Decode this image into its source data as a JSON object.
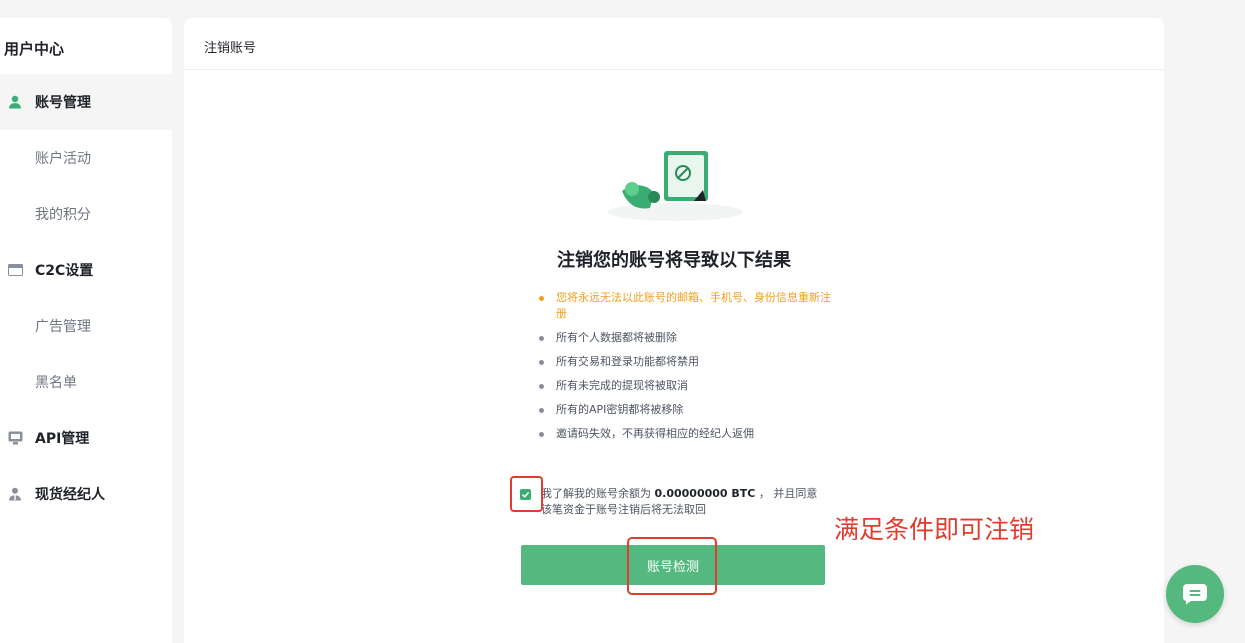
{
  "sidebar": {
    "title": "用户中心",
    "items": [
      {
        "label": "账号管理",
        "icon": "user-icon"
      },
      {
        "label": "账户活动"
      },
      {
        "label": "我的积分"
      },
      {
        "label": "C2C设置",
        "icon": "card-icon"
      },
      {
        "label": "广告管理"
      },
      {
        "label": "黑名单"
      },
      {
        "label": "API管理",
        "icon": "api-icon"
      },
      {
        "label": "现货经纪人",
        "icon": "broker-icon"
      }
    ]
  },
  "main": {
    "title": "注销账号",
    "heading": "注销您的账号将导致以下结果",
    "consequences": [
      "您将永远无法以此账号的邮箱、手机号、身份信息重新注册",
      "所有个人数据都将被删除",
      "所有交易和登录功能都将禁用",
      "所有未完成的提现将被取消",
      "所有的API密钥都将被移除",
      "邀请码失效，不再获得相应的经纪人返佣"
    ],
    "agreement": {
      "prefix": "我了解我的账号余额为",
      "balance": "0.00000000 BTC",
      "suffix": "， 并且同意该笔资金于账号注销后将无法取回",
      "checked": true
    },
    "check_button": "账号检测"
  },
  "annotation": "满足条件即可注销",
  "colors": {
    "accent": "#55b97f",
    "warning": "#f0a020",
    "highlight": "#e03c2f"
  }
}
